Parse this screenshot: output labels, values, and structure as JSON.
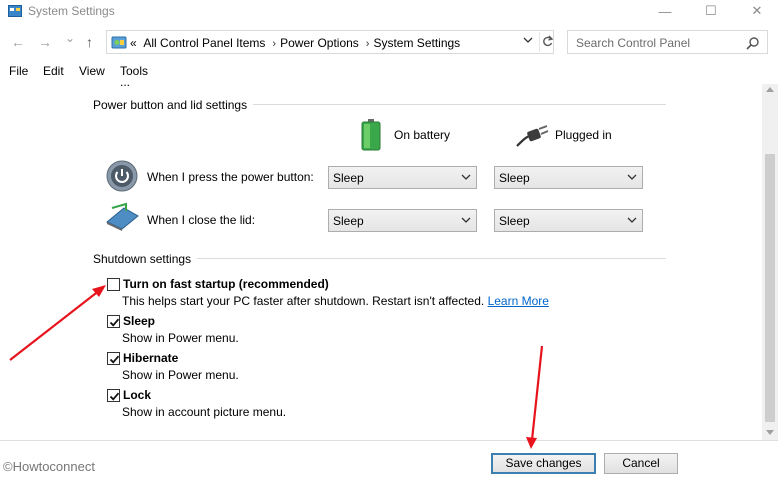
{
  "window": {
    "title": "System Settings",
    "controls": {
      "minimize": "—",
      "maximize": "☐",
      "close": "✕"
    }
  },
  "nav": {
    "back": "←",
    "forward": "→",
    "recent": "⌄",
    "up": "↑",
    "breadcrumb_prefix": "«",
    "breadcrumbs": [
      "All Control Panel Items",
      "Power Options",
      "System Settings"
    ],
    "separator": "›",
    "search_placeholder": "Search Control Panel"
  },
  "menu": [
    "File",
    "Edit",
    "View",
    "Tools"
  ],
  "content": {
    "clipped_line": "...",
    "power_group": {
      "title": "Power button and lid settings",
      "col_battery": "On battery",
      "col_plugged": "Plugged in",
      "rows": [
        {
          "label": "When I press the power button:",
          "battery": "Sleep",
          "plugged": "Sleep"
        },
        {
          "label": "When I close the lid:",
          "battery": "Sleep",
          "plugged": "Sleep"
        }
      ]
    },
    "shutdown_group": {
      "title": "Shutdown settings",
      "items": [
        {
          "label": "Turn on fast startup (recommended)",
          "desc": "This helps start your PC faster after shutdown. Restart isn't affected.",
          "link": "Learn More",
          "checked": false
        },
        {
          "label": "Sleep",
          "desc": "Show in Power menu.",
          "checked": true
        },
        {
          "label": "Hibernate",
          "desc": "Show in Power menu.",
          "checked": true
        },
        {
          "label": "Lock",
          "desc": "Show in account picture menu.",
          "checked": true
        }
      ]
    }
  },
  "footer": {
    "watermark": "©Howtoconnect",
    "save_label": "Save changes",
    "cancel_label": "Cancel"
  },
  "colors": {
    "accent_link": "#0066cc",
    "annotation_arrow": "#e8141d",
    "button_focus_border": "#3c7fb1"
  }
}
